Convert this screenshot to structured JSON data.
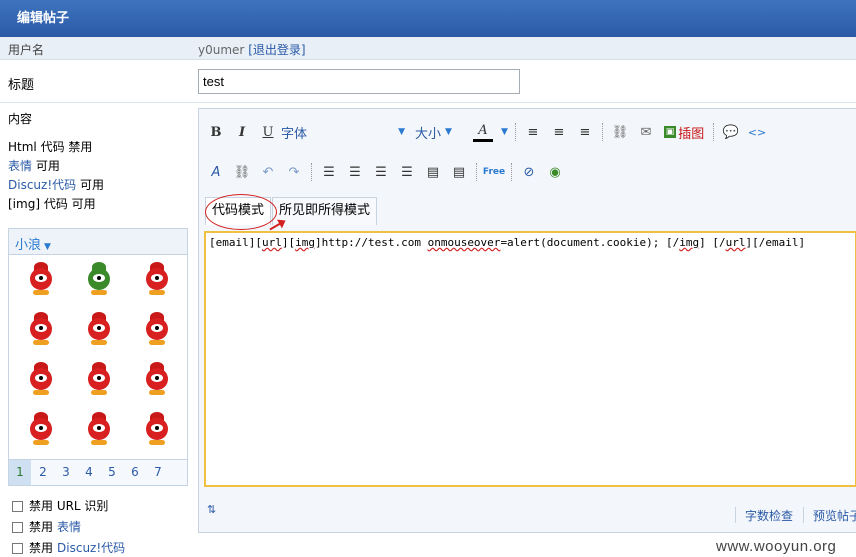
{
  "header": {
    "title": "编辑帖子"
  },
  "user_row": {
    "label": "用户名",
    "username": "y0umer",
    "logout": "退出登录"
  },
  "title_row": {
    "label": "标题",
    "value": "test"
  },
  "content": {
    "label": "内容",
    "rules": [
      {
        "name": "Html 代码",
        "state": "禁用",
        "linked": false
      },
      {
        "name": "表情",
        "state": "可用",
        "linked": true
      },
      {
        "name": "Discuz!代码",
        "state": "可用",
        "linked": true
      },
      {
        "name": "[img] 代码",
        "state": "可用",
        "linked": false
      }
    ]
  },
  "smilies": {
    "category": "小浪",
    "pages": [
      "1",
      "2",
      "3",
      "4",
      "5",
      "6",
      "7"
    ],
    "active_page": "1"
  },
  "options": [
    {
      "label": "禁用 URL 识别",
      "link": ""
    },
    {
      "label": "禁用",
      "link": "表情"
    },
    {
      "label": "禁用",
      "link": "Discuz!代码"
    }
  ],
  "toolbar": {
    "bold": "B",
    "italic": "I",
    "underline": "U",
    "font_label": "字体",
    "size_label": "大小",
    "color_label": "A",
    "image_label": "插图",
    "code_label": "<>",
    "free_label": "Free"
  },
  "tabs": [
    {
      "label": "代码模式",
      "active": true
    },
    {
      "label": "所见即所得模式",
      "active": false
    }
  ],
  "editor": {
    "content_before": "[email][",
    "content_url1": "url",
    "content_mid1": "][",
    "content_img1": "img",
    "content_mid2": "]http://test.com ",
    "content_onmouse": "onmouseover",
    "content_mid3": "=alert(document.cookie); [/",
    "content_img2": "img",
    "content_mid4": "] [/",
    "content_url2": "url",
    "content_end": "][/email]"
  },
  "bottom": {
    "wordcount": "字数检查",
    "preview": "预览帖子"
  },
  "watermark": "www.wooyun.org"
}
